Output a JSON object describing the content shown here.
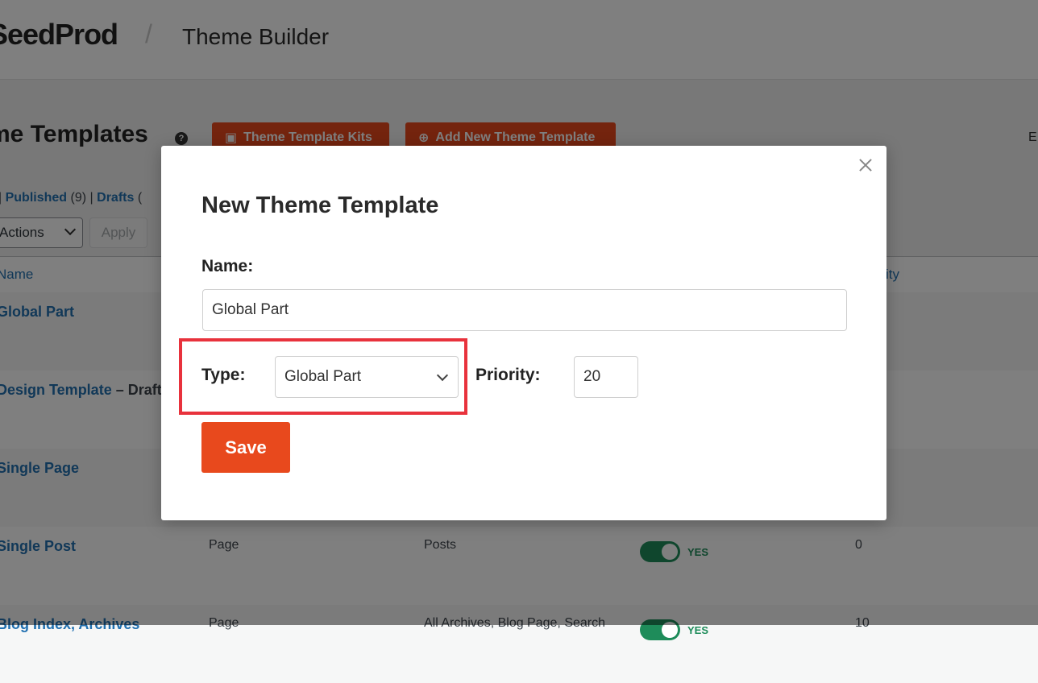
{
  "header": {
    "logo": "SeedProd",
    "separator": "/",
    "section": "Theme Builder"
  },
  "page": {
    "title": "me Templates",
    "help_icon": "?",
    "kits_button": "Theme Template Kits",
    "add_button": "Add New Theme Template",
    "edge_text": "E"
  },
  "filters": {
    "sep1": "|",
    "published": "Published",
    "published_count": "(9)",
    "sep2": "|",
    "drafts": "Drafts",
    "drafts_paren": "("
  },
  "bulk": {
    "select_value": "Actions",
    "apply": "Apply"
  },
  "table": {
    "col_name": "Name",
    "col_priority": "ity",
    "rows": [
      {
        "title": "Global Part",
        "suffix": "",
        "type": "",
        "conditions": "",
        "active": "",
        "priority": ""
      },
      {
        "title": "Design Template",
        "suffix": " – Draft",
        "type": "",
        "conditions": "",
        "active": "",
        "priority": ""
      },
      {
        "title": "Single Page",
        "suffix": "",
        "type": "",
        "conditions": "",
        "active": "",
        "priority": ""
      },
      {
        "title": "Single Post",
        "suffix": "",
        "type": "Page",
        "conditions": "Posts",
        "active": "YES",
        "priority": "0"
      },
      {
        "title": "Blog Index, Archives",
        "suffix": "",
        "type": "Page",
        "conditions": "All Archives, Blog Page, Search",
        "active": "YES",
        "priority": "10"
      }
    ]
  },
  "modal": {
    "title": "New Theme Template",
    "name_label": "Name:",
    "name_value": "Global Part",
    "type_label": "Type:",
    "type_value": "Global Part",
    "priority_label": "Priority:",
    "priority_value": "20",
    "save_label": "Save",
    "highlight_color": "#e8323c"
  },
  "colors": {
    "accent": "#e8491d",
    "link": "#2271b1",
    "toggle_on": "#1e8c5a"
  }
}
